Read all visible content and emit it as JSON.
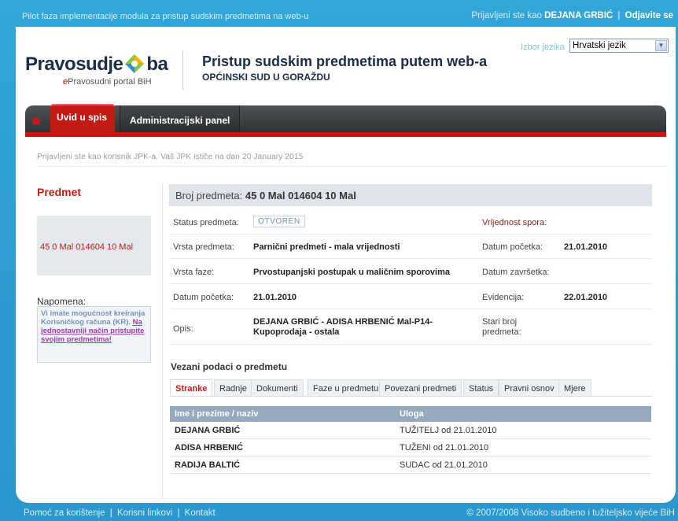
{
  "topbar": {
    "pilot_text": "Pilot faza implementacije modula za pristup sudskim predmetima na web-u",
    "login_prefix": "Prijavljeni ste kao",
    "user_name": "DEJANA GRBIĆ",
    "separator": "|",
    "logout": "Odjavite se"
  },
  "header": {
    "brand_left": "Pravosudje",
    "brand_right": "ba",
    "brand_sub_prefix": "e",
    "brand_sub_rest": "Pravosudni portal BiH",
    "title": "Pristup sudskim predmetima putem web-a",
    "subtitle": "OPĆINSKI SUD U GORAŽDU",
    "lang_label": "Izbor jezika",
    "lang_selected": "Hrvatski jezik"
  },
  "nav": {
    "tab_active": "Uvid u spis",
    "tab_admin": "Administracijski panel"
  },
  "info_line": "Prijavljeni ste kao korisnik JPK-a. Vaš JPK ističe na dan 20 January 2015",
  "left": {
    "heading": "Predmet",
    "case_number": "45 0 Mal 014604 10 Mal",
    "note_heading": "Napomena:",
    "note_text": "Vi imate mogućnost kreiranja Korisničkog računa (KR).",
    "note_link": "Na jednostavniji način pristupite svojim predmetima!"
  },
  "case": {
    "head_label": "Broj predmeta:",
    "head_value": "45 0 Mal 014604 10 Mal",
    "status_label": "Status predmeta:",
    "status_value": "OTVOREN",
    "vrijednost_label": "Vrijednost spora:",
    "vrijednost_value": "",
    "vrsta_label": "Vrsta predmeta:",
    "vrsta_value": "Parnični predmeti - mala vrijednosti",
    "datum_poc_label_r": "Datum početka:",
    "datum_poc_value_r": "21.01.2010",
    "faza_label": "Vrsta faze:",
    "faza_value": "Prvostupanjski postupak u maličnim sporovima",
    "datum_zav_label": "Datum završetka:",
    "datum_zav_value": "",
    "datum_poc_label_l": "Datum početka:",
    "datum_poc_value_l": "21.01.2010",
    "evidencija_label": "Evidencija:",
    "evidencija_value": "22.01.2010",
    "opis_label": "Opis:",
    "opis_value": "DEJANA GRBIĆ - ADISA HRBENIĆ Mal-P14-Kupoprodaja - ostala",
    "stari_label": "Stari broj predmeta:",
    "stari_value": ""
  },
  "related": {
    "heading": "Vezani podaci o predmetu",
    "tabs": [
      "Stranke",
      "Radnje",
      "Dokumenti",
      "Faze u predmetu",
      "Povezani predmeti",
      "Status",
      "Pravni osnov",
      "Mjere"
    ],
    "columns": [
      "Ime i prezime / naziv",
      "Uloga"
    ],
    "rows": [
      {
        "name": "DEJANA GRBIĆ",
        "role": "TUŽITELJ od 21.01.2010"
      },
      {
        "name": "ADISA HRBENIĆ",
        "role": "TUŽENI od 21.01.2010"
      },
      {
        "name": "RADIJA BALTIĆ",
        "role": "SUDAC od 21.01.2010"
      }
    ]
  },
  "footer": {
    "links": [
      "Pomoć za korištenje",
      "Korisni linkovi",
      "Kontakt"
    ],
    "separator": "|",
    "copyright": "© 2007/2008 Visoko sudbeno i tužiteljsko vijeće BiH"
  },
  "colors": {
    "accent_red": "#c41a16",
    "page_blue": "#2b9ad0",
    "nav_dark": "#3a3e42"
  }
}
